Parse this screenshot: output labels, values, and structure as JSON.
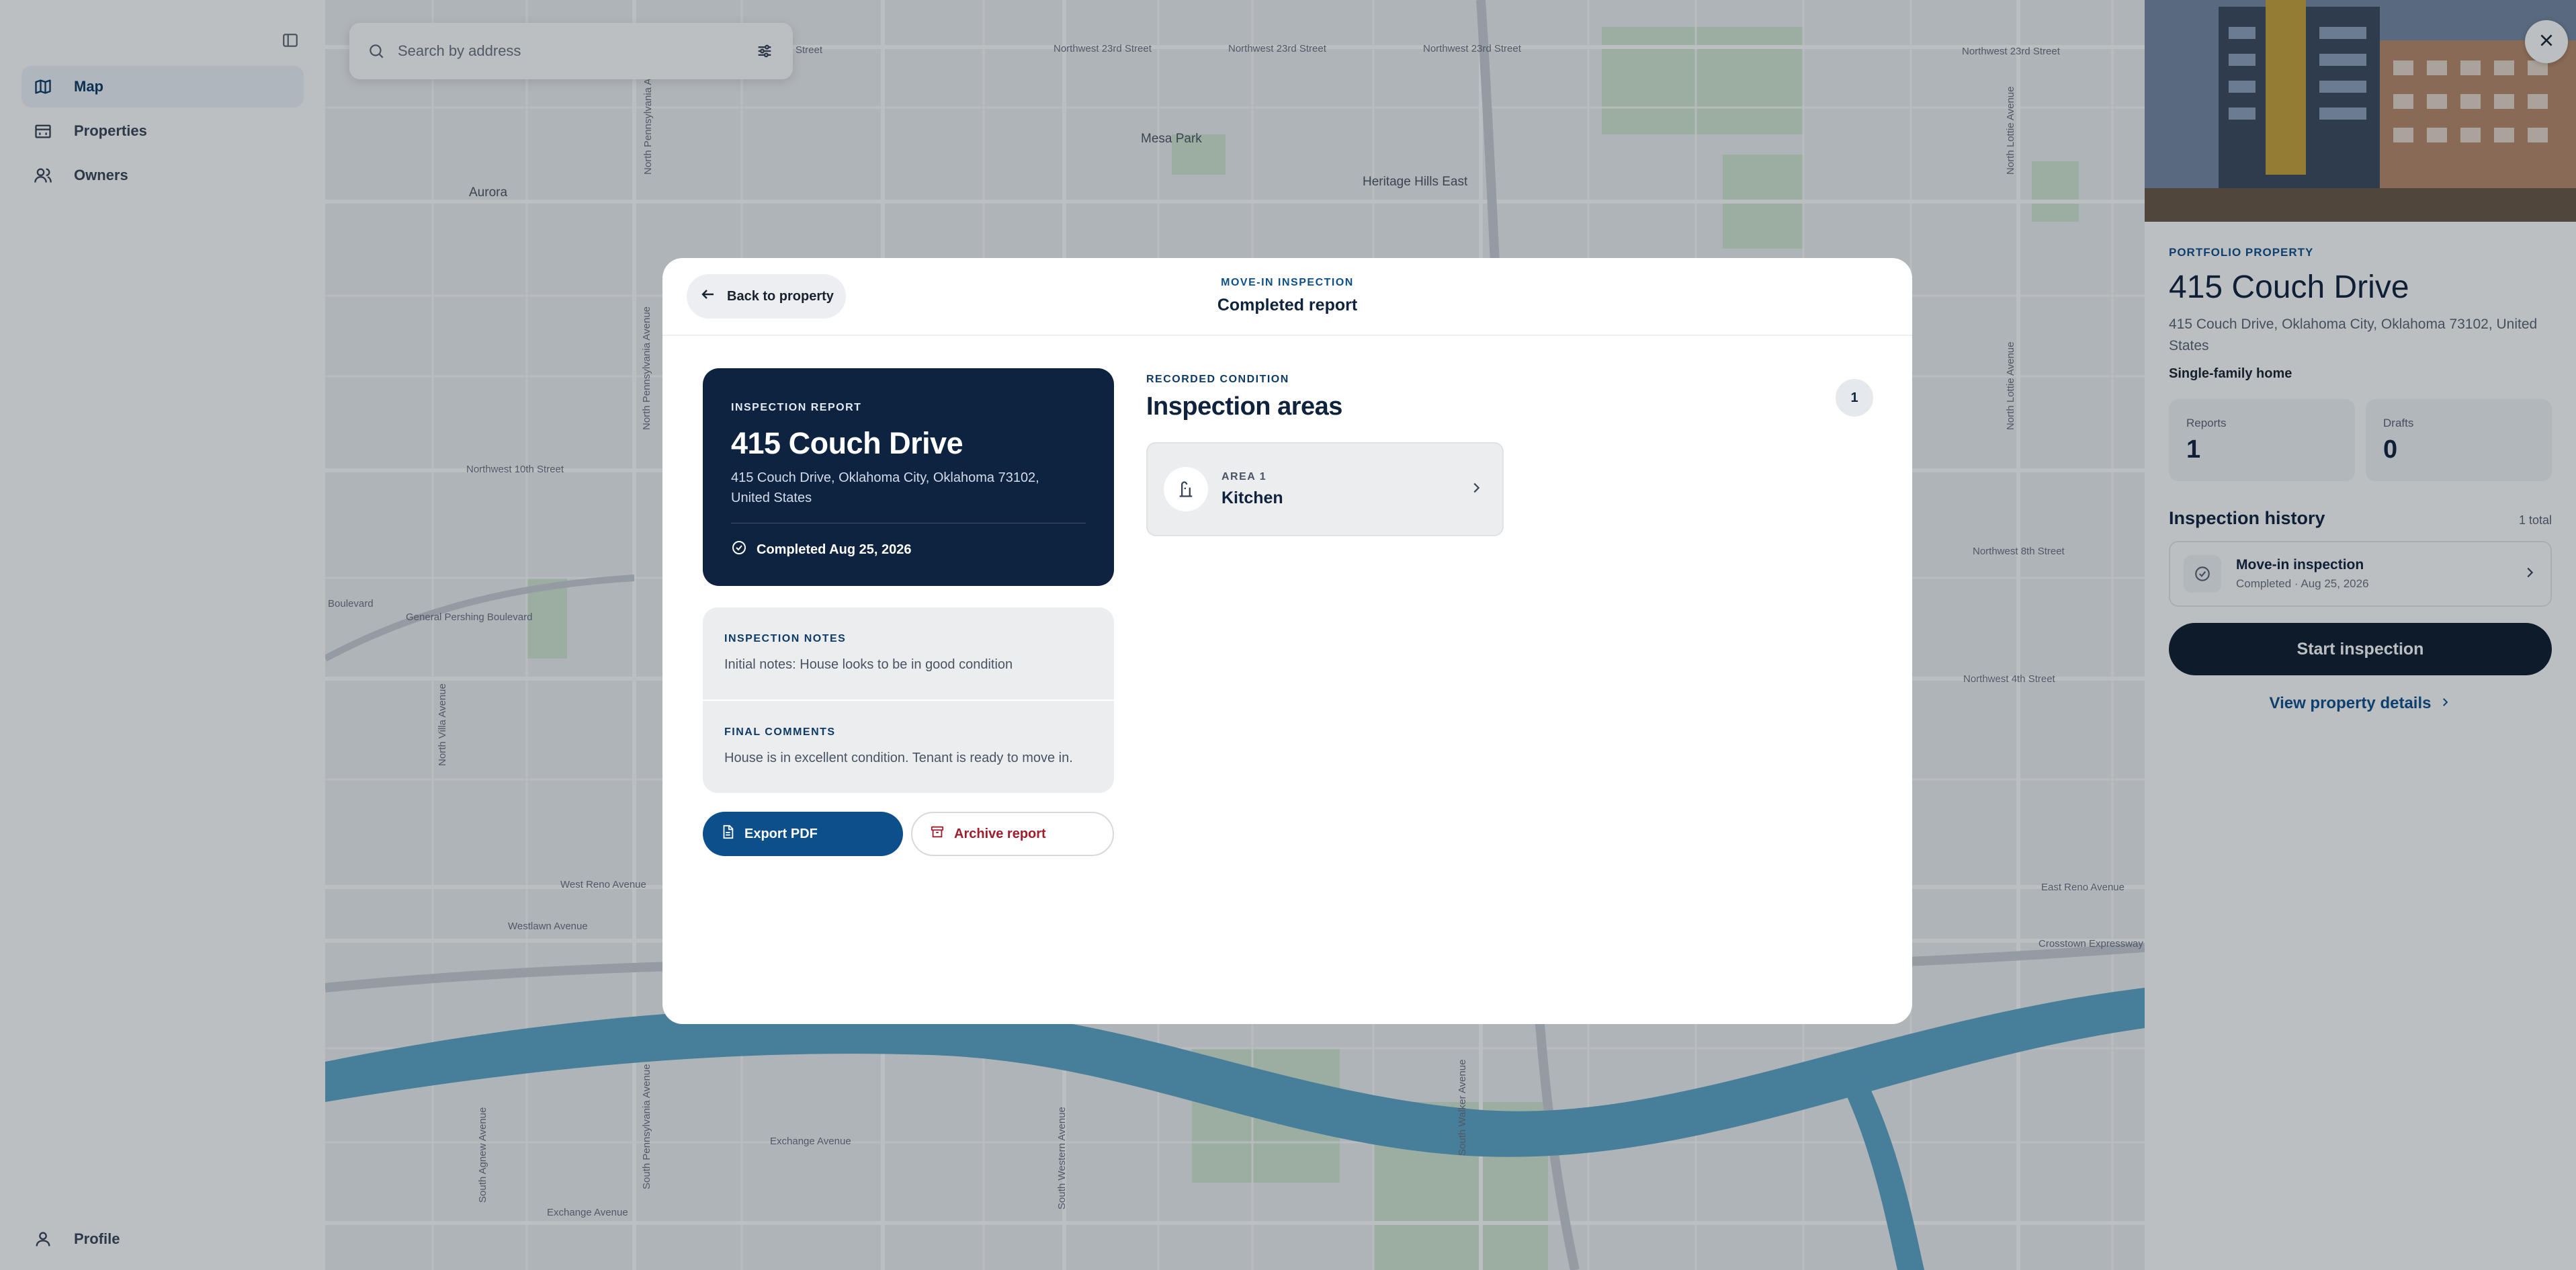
{
  "sidebar": {
    "items": [
      {
        "label": "Map",
        "icon": "map-icon",
        "active": true
      },
      {
        "label": "Properties",
        "icon": "building-icon",
        "active": false
      },
      {
        "label": "Owners",
        "icon": "users-icon",
        "active": false
      }
    ],
    "profile_label": "Profile"
  },
  "search": {
    "placeholder": "Search by address"
  },
  "map": {
    "labels": {
      "nw23_a": "Northwest 23rd Street",
      "nw23_b": "Northwest 23rd Street",
      "nw23_c": "Northwest 23rd Street",
      "nw23_d": "Northwest 23rd Street",
      "st_a": "Street",
      "mesa_park": "Mesa Park",
      "heritage": "Heritage Hills East",
      "aurora": "Aurora",
      "nw10": "Northwest 10th Street",
      "nw4": "Northwest 4th Street",
      "nw8": "Northwest 8th Street",
      "boulevard": "Boulevard",
      "west_reno": "West Reno Avenue",
      "east_reno": "East Reno Avenue",
      "westlawn": "Westlawn Avenue",
      "exchange_a": "Exchange Avenue",
      "exchange_b": "Exchange Avenue",
      "crosstown": "Crosstown Expressway",
      "general_pershing": "General Pershing Boulevard",
      "n_penn_a": "North Pennsylvania Avenue",
      "n_penn_b": "North Pennsylvania Avenue",
      "n_villa": "North Villa Avenue",
      "n_lottie_a": "North Lottie Avenue",
      "n_lottie_b": "North Lottie Avenue",
      "s_penn": "South Pennsylvania Avenue",
      "s_agnew": "South Agnew Avenue",
      "s_western": "South Western Avenue",
      "s_walker": "South Walker Avenue"
    },
    "colors": {
      "water": "#5ea7c9",
      "park": "#d3e6d3",
      "road": "#ffffff",
      "land": "#eef0f2"
    }
  },
  "panel": {
    "eyebrow": "PORTFOLIO PROPERTY",
    "title": "415 Couch Drive",
    "address": "415 Couch Drive, Oklahoma City, Oklahoma 73102, United States",
    "type": "Single-family home",
    "stats": [
      {
        "label": "Reports",
        "value": "1"
      },
      {
        "label": "Drafts",
        "value": "0"
      }
    ],
    "history_title": "Inspection history",
    "history_count": "1 total",
    "history_items": [
      {
        "title": "Move-in inspection",
        "subtitle": "Completed · Aug 25, 2026"
      }
    ],
    "start_label": "Start inspection",
    "details_label": "View property details"
  },
  "modal": {
    "back_label": "Back to property",
    "header_eyebrow": "MOVE-IN INSPECTION",
    "header_title": "Completed report",
    "report": {
      "eyebrow": "INSPECTION REPORT",
      "title": "415 Couch Drive",
      "address": "415 Couch Drive, Oklahoma City, Oklahoma 73102, United States",
      "completed": "Completed Aug 25, 2026"
    },
    "notes_label": "INSPECTION NOTES",
    "notes_value": "Initial notes: House looks to be in good condition",
    "final_label": "FINAL COMMENTS",
    "final_value": "House is in excellent condition. Tenant is ready to move in.",
    "export_label": "Export PDF",
    "archive_label": "Archive report",
    "areas_eyebrow": "RECORDED CONDITION",
    "areas_title": "Inspection areas",
    "areas_count": "1",
    "areas": [
      {
        "eyebrow": "AREA 1",
        "title": "Kitchen"
      }
    ]
  }
}
